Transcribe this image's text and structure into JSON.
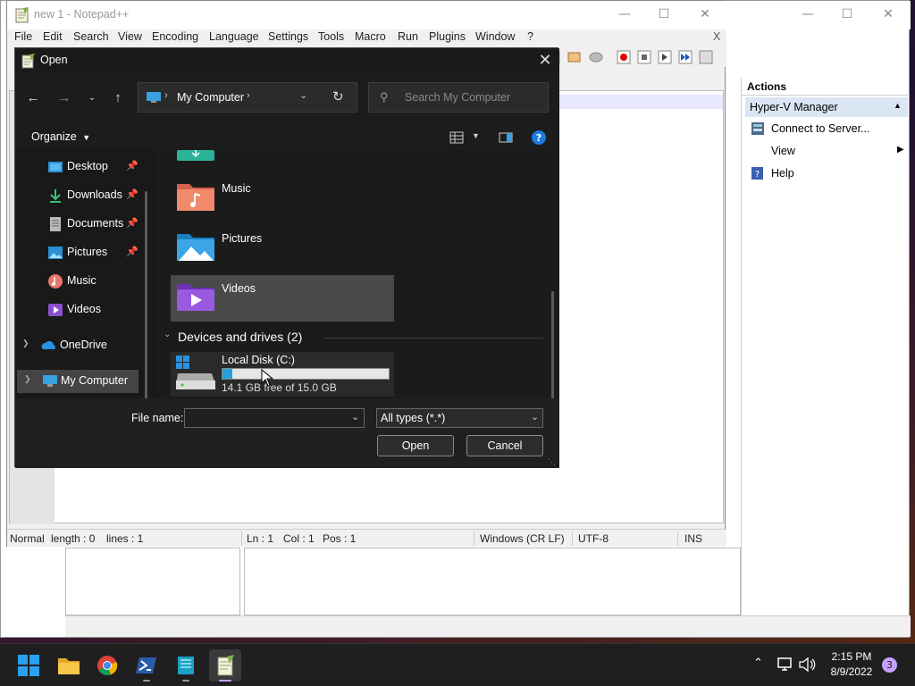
{
  "notepad": {
    "title": "new 1 - Notepad++",
    "menu": [
      "File",
      "Edit",
      "Search",
      "View",
      "Encoding",
      "Language",
      "Settings",
      "Tools",
      "Macro",
      "Run",
      "Plugins",
      "Window",
      "?"
    ],
    "close_x": "X",
    "status": {
      "mode": "Normal",
      "length": "length : 0",
      "lines": "lines : 1",
      "ln": "Ln : 1",
      "col": "Col : 1",
      "pos": "Pos : 1",
      "eol": "Windows (CR LF)",
      "encoding": "UTF-8",
      "ins": "INS"
    }
  },
  "hyperv": {
    "actions_header": "Actions",
    "section": "Hyper-V Manager",
    "items": [
      {
        "label": "Connect to Server...",
        "icon": "server-icon"
      },
      {
        "label": "View",
        "icon": "none"
      },
      {
        "label": "Help",
        "icon": "help-icon"
      }
    ]
  },
  "dialog": {
    "title": "Open",
    "address": "My Computer",
    "search_placeholder": "Search My Computer",
    "organize": "Organize",
    "sidebar": [
      {
        "label": "Desktop",
        "icon": "desktop-icon",
        "pinned": true
      },
      {
        "label": "Downloads",
        "icon": "download-icon",
        "pinned": true
      },
      {
        "label": "Documents",
        "icon": "documents-icon",
        "pinned": true
      },
      {
        "label": "Pictures",
        "icon": "pictures-icon",
        "pinned": true
      },
      {
        "label": "Music",
        "icon": "music-icon",
        "pinned": false
      },
      {
        "label": "Videos",
        "icon": "videos-icon",
        "pinned": false
      }
    ],
    "onedrive": "OneDrive",
    "mycomputer": "My Computer",
    "folders": [
      {
        "label": "Music",
        "color": "#e8756a"
      },
      {
        "label": "Pictures",
        "color": "#3aa0e0"
      },
      {
        "label": "Videos",
        "color": "#8a4fd0"
      }
    ],
    "devices_header": "Devices and drives (2)",
    "drive": {
      "label": "Local Disk (C:)",
      "free_text": "14.1 GB free of 15.0 GB",
      "used_fraction": 0.06
    },
    "filename_label": "File name:",
    "filename_value": "",
    "filetype": "All types (*.*)",
    "open_btn": "Open",
    "cancel_btn": "Cancel"
  },
  "taskbar": {
    "time": "2:15 PM",
    "date": "8/9/2022",
    "notification_count": "3"
  },
  "colors": {
    "accent": "#0078d4",
    "dialog_bg": "#202020",
    "selected_tile": "#4a4a4a"
  }
}
